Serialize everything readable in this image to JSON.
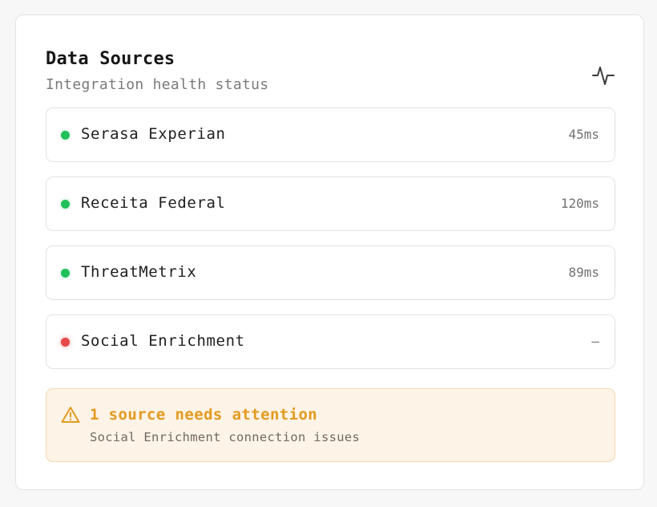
{
  "header": {
    "title": "Data Sources",
    "subtitle": "Integration health status",
    "icon": "activity-icon"
  },
  "sources": [
    {
      "name": "Serasa Experian",
      "latency": "45ms",
      "status": "ok",
      "status_color": "#22c05a"
    },
    {
      "name": "Receita Federal",
      "latency": "120ms",
      "status": "ok",
      "status_color": "#22c05a"
    },
    {
      "name": "ThreatMetrix",
      "latency": "89ms",
      "status": "ok",
      "status_color": "#22c05a"
    },
    {
      "name": "Social Enrichment",
      "latency": "—",
      "status": "down",
      "status_color": "#e54848"
    }
  ],
  "alert": {
    "icon": "warning-triangle-icon",
    "headline": "1 source needs attention",
    "detail": "Social Enrichment connection issues",
    "accent_color": "#e39a1f"
  }
}
